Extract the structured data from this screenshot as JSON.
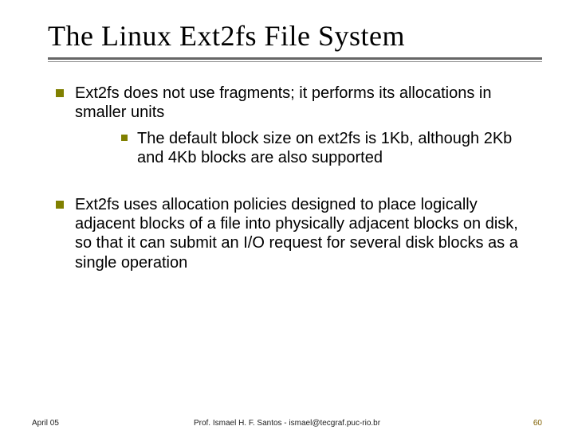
{
  "title": "The Linux Ext2fs File System",
  "bullets": [
    {
      "text": "Ext2fs does not use fragments; it performs its allocations in smaller units",
      "sub": [
        "The default block size on ext2fs is 1Kb, although 2Kb and 4Kb blocks are also supported"
      ]
    },
    {
      "text": "Ext2fs uses allocation policies designed to place logically adjacent blocks of a file into physically adjacent blocks on disk, so that it can submit an I/O request for several disk blocks as a single operation",
      "sub": []
    }
  ],
  "footer": {
    "date": "April 05",
    "center": "Prof. Ismael H. F. Santos - ismael@tecgraf.puc-rio.br",
    "page": "60"
  }
}
